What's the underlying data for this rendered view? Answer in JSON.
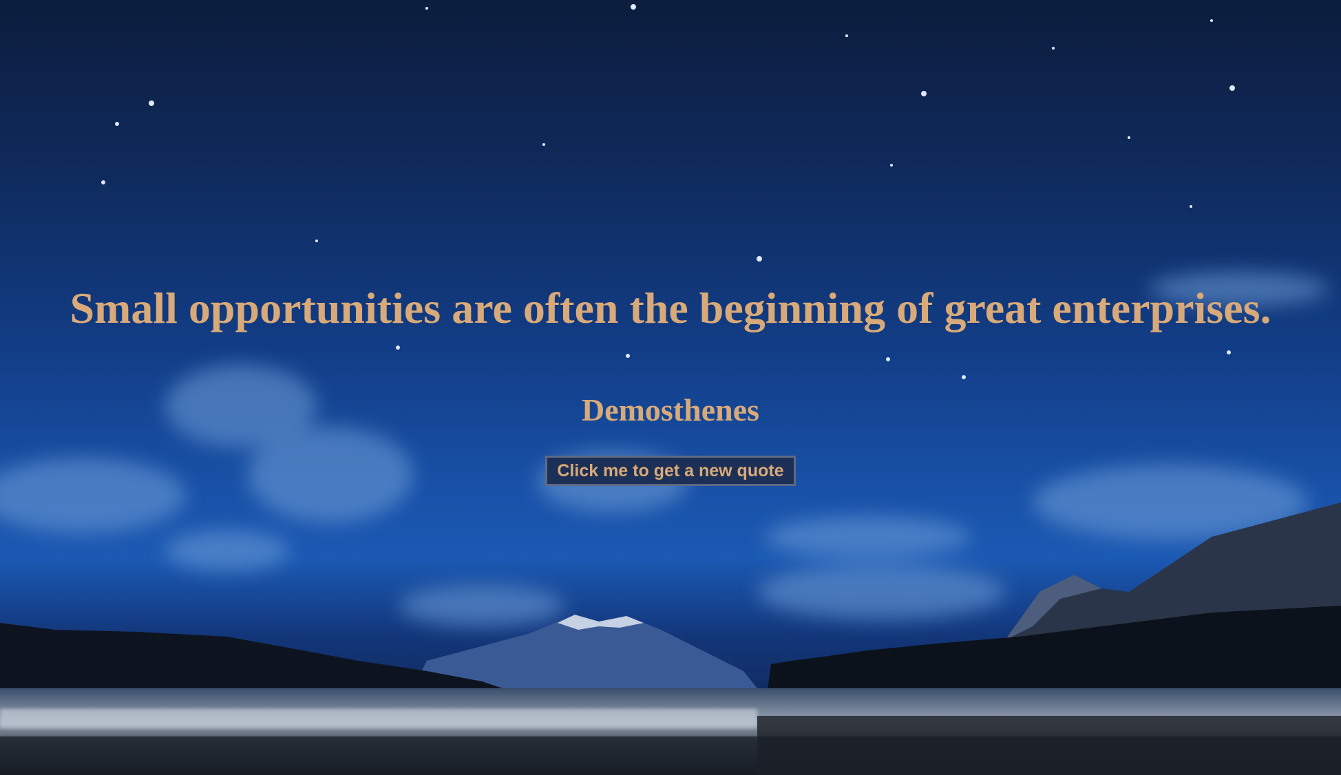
{
  "quote": {
    "text": "Small opportunities are often the beginning of great enterprises.",
    "author": "Demosthenes"
  },
  "actions": {
    "new_quote_label": "Click me to get a new quote"
  },
  "colors": {
    "quote_text": "#d9aa79",
    "button_background": "#1c2f56",
    "sky_top": "#0c1d3d",
    "sky_mid": "#1850a6"
  },
  "background": {
    "icon": "night-sky-mountain-lake-image"
  }
}
